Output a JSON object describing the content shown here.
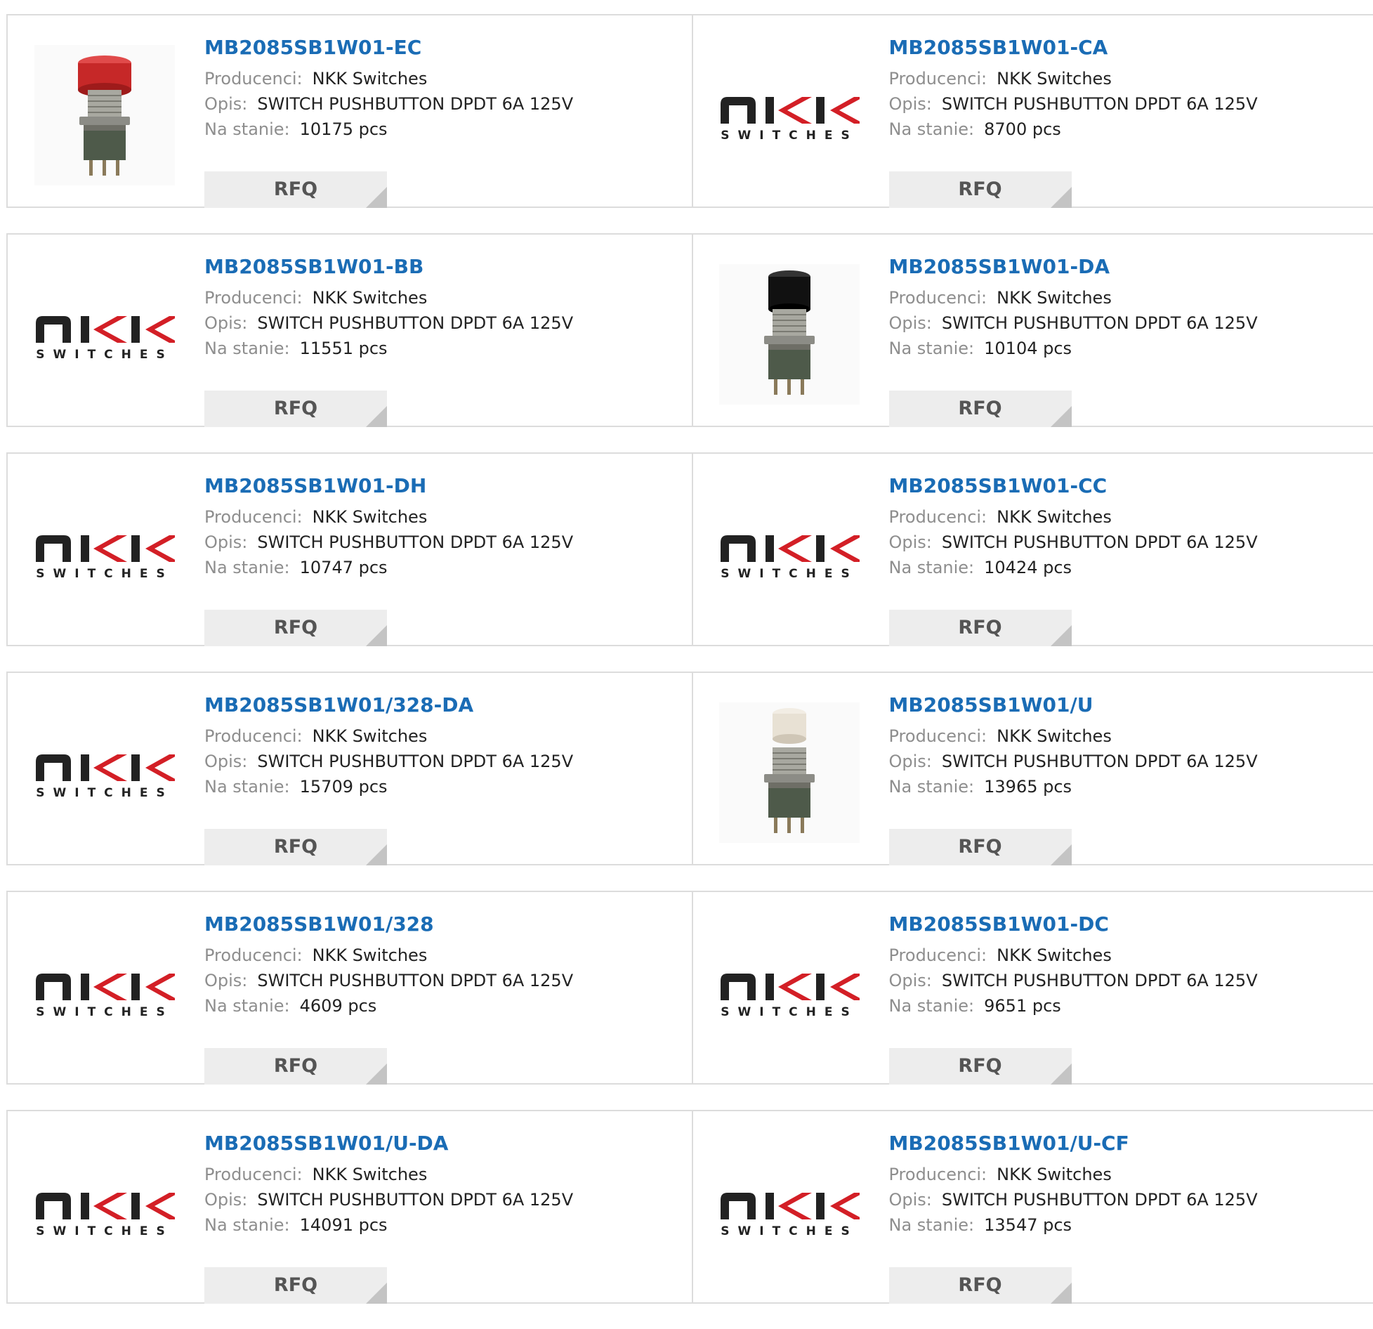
{
  "labels": {
    "manufacturer": "Producenci:",
    "description": "Opis:",
    "stock": "Na stanie:",
    "rfq": "RFQ"
  },
  "logo": {
    "brand": "NKK",
    "tagline": "SWITCHES"
  },
  "colors": {
    "part_link": "#1a6cb5",
    "label_gray": "#8e8e8e",
    "button_bg": "#ededed",
    "border": "#dcdcdc"
  },
  "products": [
    {
      "part": "MB2085SB1W01-EC",
      "manufacturer": "NKK Switches",
      "description": "SWITCH PUSHBUTTON DPDT 6A 125V",
      "stock": "10175 pcs",
      "image": "switch-photo-red-cap"
    },
    {
      "part": "MB2085SB1W01-CA",
      "manufacturer": "NKK Switches",
      "description": "SWITCH PUSHBUTTON DPDT 6A 125V",
      "stock": "8700 pcs",
      "image": "nkk-switches-logo"
    },
    {
      "part": "MB2085SB1W01-BB",
      "manufacturer": "NKK Switches",
      "description": "SWITCH PUSHBUTTON DPDT 6A 125V",
      "stock": "11551 pcs",
      "image": "nkk-switches-logo"
    },
    {
      "part": "MB2085SB1W01-DA",
      "manufacturer": "NKK Switches",
      "description": "SWITCH PUSHBUTTON DPDT 6A 125V",
      "stock": "10104 pcs",
      "image": "switch-photo-black-cap"
    },
    {
      "part": "MB2085SB1W01-DH",
      "manufacturer": "NKK Switches",
      "description": "SWITCH PUSHBUTTON DPDT 6A 125V",
      "stock": "10747 pcs",
      "image": "nkk-switches-logo"
    },
    {
      "part": "MB2085SB1W01-CC",
      "manufacturer": "NKK Switches",
      "description": "SWITCH PUSHBUTTON DPDT 6A 125V",
      "stock": "10424 pcs",
      "image": "nkk-switches-logo"
    },
    {
      "part": "MB2085SB1W01/328-DA",
      "manufacturer": "NKK Switches",
      "description": "SWITCH PUSHBUTTON DPDT 6A 125V",
      "stock": "15709 pcs",
      "image": "nkk-switches-logo"
    },
    {
      "part": "MB2085SB1W01/U",
      "manufacturer": "NKK Switches",
      "description": "SWITCH PUSHBUTTON DPDT 6A 125V",
      "stock": "13965 pcs",
      "image": "switch-photo-white-cap"
    },
    {
      "part": "MB2085SB1W01/328",
      "manufacturer": "NKK Switches",
      "description": "SWITCH PUSHBUTTON DPDT 6A 125V",
      "stock": "4609 pcs",
      "image": "nkk-switches-logo"
    },
    {
      "part": "MB2085SB1W01-DC",
      "manufacturer": "NKK Switches",
      "description": "SWITCH PUSHBUTTON DPDT 6A 125V",
      "stock": "9651 pcs",
      "image": "nkk-switches-logo"
    },
    {
      "part": "MB2085SB1W01/U-DA",
      "manufacturer": "NKK Switches",
      "description": "SWITCH PUSHBUTTON DPDT 6A 125V",
      "stock": "14091 pcs",
      "image": "nkk-switches-logo"
    },
    {
      "part": "MB2085SB1W01/U-CF",
      "manufacturer": "NKK Switches",
      "description": "SWITCH PUSHBUTTON DPDT 6A 125V",
      "stock": "13547 pcs",
      "image": "nkk-switches-logo"
    }
  ]
}
